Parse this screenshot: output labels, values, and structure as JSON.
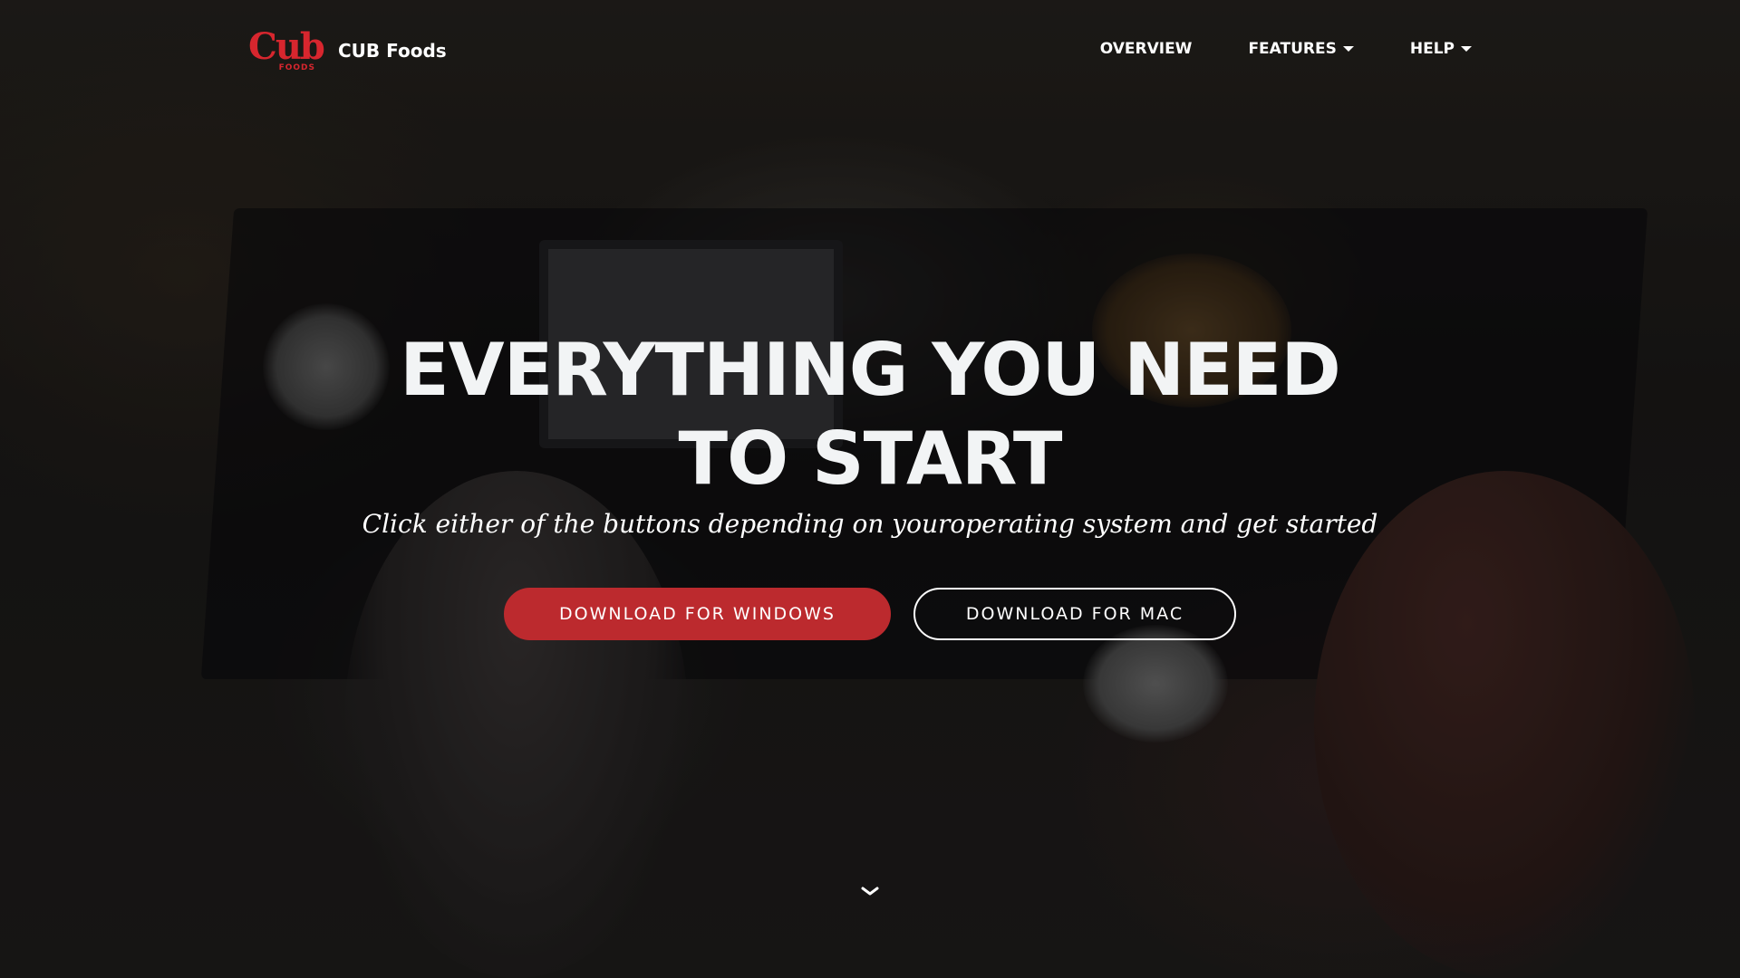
{
  "nav": {
    "brand_name": "CUB Foods",
    "logo_text": "Cub",
    "logo_subtext": "FOODS",
    "links": [
      {
        "label": "OVERVIEW",
        "has_dropdown": false
      },
      {
        "label": "FEATURES",
        "has_dropdown": true
      },
      {
        "label": "HELP",
        "has_dropdown": true
      }
    ]
  },
  "hero": {
    "headline_line1": "EVERYTHING YOU NEED",
    "headline_line2": "TO START",
    "subheadline": "Click either of the buttons depending on youroperating system and get started",
    "primary_button": "DOWNLOAD FOR WINDOWS",
    "secondary_button": "DOWNLOAD FOR MAC",
    "scroll_icon": "chevron-down-icon"
  },
  "colors": {
    "brand_red": "#d7262e",
    "button_red": "#bc2a2e",
    "text": "#ffffff"
  }
}
